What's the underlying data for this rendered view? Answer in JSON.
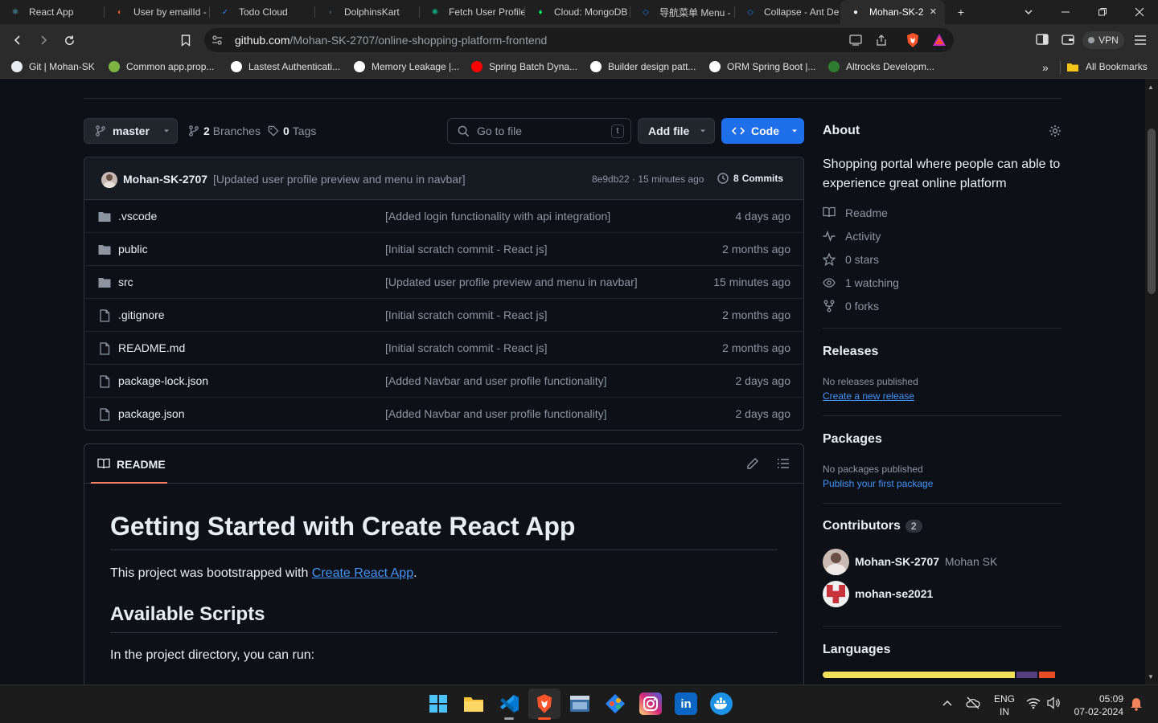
{
  "browser": {
    "tabs": [
      {
        "label": "React App",
        "color": "#61dafb",
        "glyph": "⚛"
      },
      {
        "label": "User by emailId -",
        "color": "#ef5b25",
        "glyph": "◐"
      },
      {
        "label": "Todo Cloud",
        "color": "#2f81f7",
        "glyph": "✓"
      },
      {
        "label": "DolphinsKart",
        "color": "#444c56",
        "glyph": "◗"
      },
      {
        "label": "Fetch User Profile",
        "color": "#10a37f",
        "glyph": "✺"
      },
      {
        "label": "Cloud: MongoDB",
        "color": "#00ed64",
        "glyph": "♦"
      },
      {
        "label": "导航菜单 Menu -",
        "color": "#1677ff",
        "glyph": "◇"
      },
      {
        "label": "Collapse - Ant De",
        "color": "#1677ff",
        "glyph": "◇"
      },
      {
        "label": "Mohan-SK-2",
        "color": "#e6edf3",
        "glyph": "●"
      }
    ],
    "new_tab": "+",
    "url_host": "github.com",
    "url_path": "/Mohan-SK-2707/online-shopping-platform-frontend",
    "vpn_label": "VPN",
    "bookmarks": [
      {
        "label": "Git | Mohan-SK",
        "color": "#e6edf3"
      },
      {
        "label": "Common app.prop...",
        "color": "#7cb342"
      },
      {
        "label": "Lastest Authenticati...",
        "color": "#ffffff"
      },
      {
        "label": "Memory Leakage |...",
        "color": "#ffffff"
      },
      {
        "label": "Spring Batch Dyna...",
        "color": "#ff0000"
      },
      {
        "label": "Builder design patt...",
        "color": "#ffffff"
      },
      {
        "label": "ORM Spring Boot |...",
        "color": "#ffffff"
      },
      {
        "label": "Altrocks Developm...",
        "color": "#2e7d32"
      }
    ],
    "more_bookmarks": "»",
    "all_bookmarks": "All Bookmarks"
  },
  "repo": {
    "branch": "master",
    "branches_count": "2",
    "branches_label": "Branches",
    "tags_count": "0",
    "tags_label": "Tags",
    "goto_placeholder": "Go to file",
    "goto_shortcut": "t",
    "add_file": "Add file",
    "code": "Code",
    "commit": {
      "author": "Mohan-SK-2707",
      "message": "[Updated user profile preview and menu in navbar]",
      "meta": "8e9db22 · 15 minutes ago",
      "commits_count": "8",
      "commits_label": "Commits"
    },
    "files": [
      {
        "name": ".vscode",
        "type": "folder",
        "message": "[Added login functionality with api integration]",
        "time": "4 days ago"
      },
      {
        "name": "public",
        "type": "folder",
        "message": "[Initial scratch commit - React js]",
        "time": "2 months ago"
      },
      {
        "name": "src",
        "type": "folder",
        "message": "[Updated user profile preview and menu in navbar]",
        "time": "15 minutes ago"
      },
      {
        "name": ".gitignore",
        "type": "file",
        "message": "[Initial scratch commit - React js]",
        "time": "2 months ago"
      },
      {
        "name": "README.md",
        "type": "file",
        "message": "[Initial scratch commit - React js]",
        "time": "2 months ago"
      },
      {
        "name": "package-lock.json",
        "type": "file",
        "message": "[Added Navbar and user profile functionality]",
        "time": "2 days ago"
      },
      {
        "name": "package.json",
        "type": "file",
        "message": "[Added Navbar and user profile functionality]",
        "time": "2 days ago"
      }
    ],
    "readme": {
      "tab": "README",
      "h1": "Getting Started with Create React App",
      "p1_prefix": "This project was bootstrapped with ",
      "p1_link": "Create React App",
      "p1_suffix": ".",
      "h2": "Available Scripts",
      "p2": "In the project directory, you can run:"
    }
  },
  "sidebar": {
    "about_title": "About",
    "description": "Shopping portal where people can able to experience great online platform",
    "items": [
      {
        "icon": "book-icon",
        "label": "Readme"
      },
      {
        "icon": "pulse-icon",
        "label": "Activity"
      },
      {
        "icon": "star-icon",
        "label": "0 stars"
      },
      {
        "icon": "eye-icon",
        "label": "1 watching"
      },
      {
        "icon": "fork-icon",
        "label": "0 forks"
      }
    ],
    "releases_title": "Releases",
    "releases_none": "No releases published",
    "releases_link": "Create a new release",
    "packages_title": "Packages",
    "packages_none": "No packages published",
    "packages_link": "Publish your first package",
    "contributors_title": "Contributors",
    "contributors_count": "2",
    "contributors": [
      {
        "handle": "Mohan-SK-2707",
        "name": "Mohan SK"
      },
      {
        "handle": "mohan-se2021",
        "name": ""
      }
    ],
    "languages_title": "Languages",
    "language_colors": [
      "#f1e05a",
      "#563d7c",
      "#e34c26"
    ],
    "language_shares": [
      0.82,
      0.09,
      0.07
    ]
  },
  "taskbar": {
    "lang_top": "ENG",
    "lang_bottom": "IN",
    "time": "05:09",
    "date": "07-02-2024"
  }
}
